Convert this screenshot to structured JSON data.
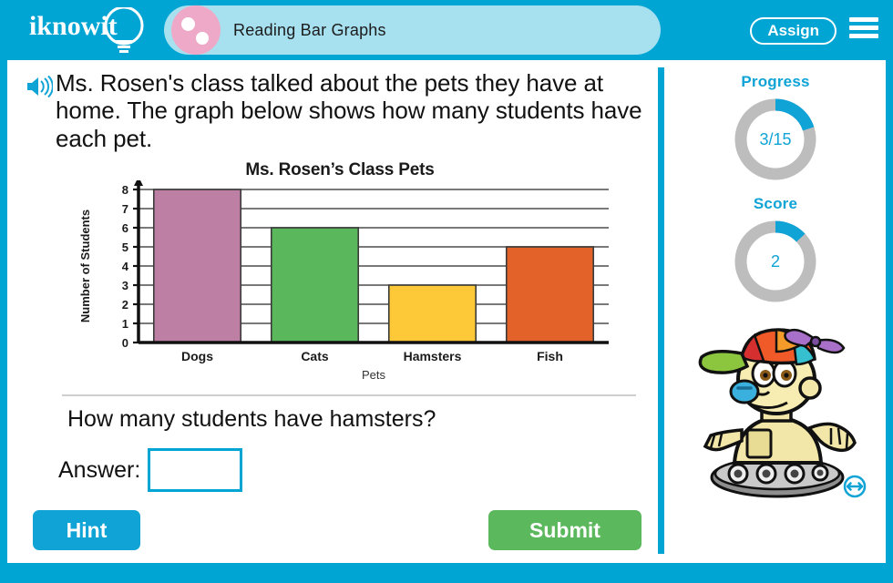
{
  "header": {
    "logo_text": "iknowit",
    "logo_icon": "lightbulb-icon",
    "lesson_title": "Reading Bar Graphs",
    "pill_icon": "two-dots-circle-icon",
    "assign_label": "Assign",
    "menu_icon": "hamburger-menu-icon",
    "bg_color": "#00a5d4",
    "pill_color": "#a7e0ef",
    "pill_icon_color": "#efa9c8"
  },
  "main": {
    "speaker_icon": "speaker-audio-icon",
    "prompt": "Ms. Rosen's class talked about the pets they have at home. The graph below shows how many students have each pet.",
    "question": "How many students have hamsters?",
    "answer_label": "Answer:",
    "answer_value": "",
    "answer_placeholder": "",
    "hint_label": "Hint",
    "submit_label": "Submit",
    "hint_color": "#0fa3d6",
    "submit_color": "#5cb85c"
  },
  "sidebar": {
    "progress_label": "Progress",
    "progress_value": "3/15",
    "progress_fraction": 0.2,
    "score_label": "Score",
    "score_value": "2",
    "score_fraction": 0.13,
    "accent_color": "#0fa3d6",
    "track_color": "#bdbdbd",
    "mascot_icon": "robot-mascot-character",
    "resize_icon": "resize-horizontal-icon"
  },
  "chart_data": {
    "type": "bar",
    "title": "Ms. Rosen’s Class Pets",
    "xlabel": "Pets",
    "ylabel": "Number of Students",
    "categories": [
      "Dogs",
      "Cats",
      "Hamsters",
      "Fish"
    ],
    "values": [
      8,
      6,
      3,
      5
    ],
    "colors": [
      "#be7fa5",
      "#5bb75b",
      "#fdc938",
      "#e2622a"
    ],
    "ylim": [
      0,
      8
    ],
    "yticks": [
      0,
      1,
      2,
      3,
      4,
      5,
      6,
      7,
      8
    ],
    "grid": true,
    "legend": "none"
  }
}
